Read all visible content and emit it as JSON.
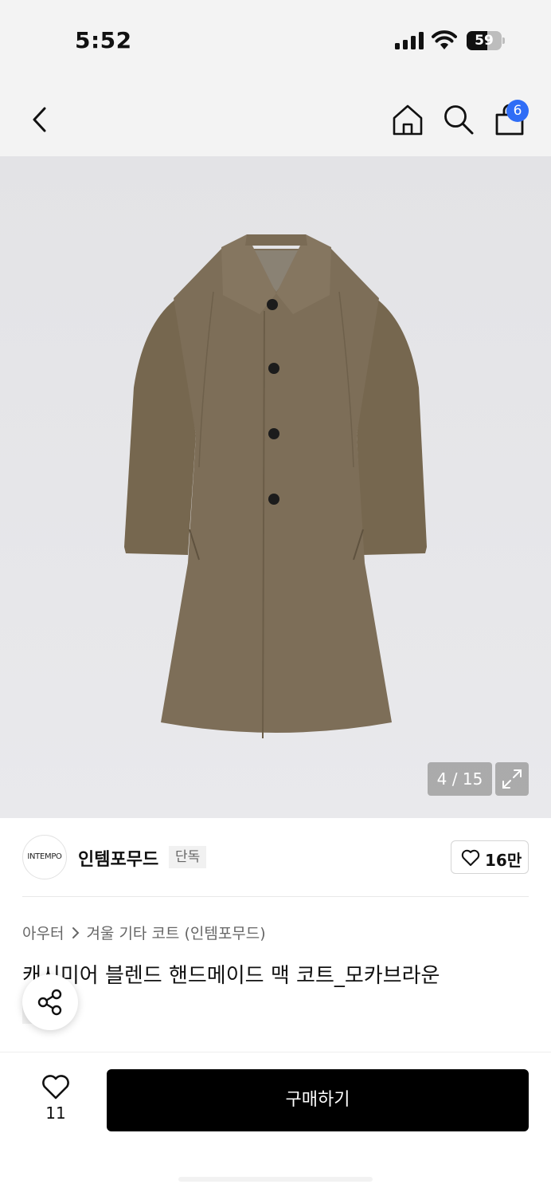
{
  "status_bar": {
    "time": "5:52",
    "battery_level": "59",
    "battery_fraction": 0.59,
    "icons": [
      "signal-icon",
      "wifi-icon",
      "battery-icon"
    ]
  },
  "nav": {
    "icons": [
      "back-icon",
      "home-icon",
      "search-icon",
      "bag-icon"
    ],
    "cart_count": "6"
  },
  "gallery": {
    "counter": "4 / 15",
    "icons": [
      "chevron-right-icon",
      "expand-icon"
    ]
  },
  "brand": {
    "logo_text": "INTEMPO",
    "name": "인템포무드",
    "tag": "단독",
    "follow_count": "16만",
    "follow_icon": "heart-outline-icon"
  },
  "product": {
    "breadcrumb": [
      "아우터",
      "겨울 기타 코트 (인템포무드)"
    ],
    "title": "캐시미어 블렌드 핸드메이드 맥 코트_모카브라운",
    "tag": "단독",
    "share_icon": "share-icon"
  },
  "bottom_bar": {
    "wish_count": "11",
    "buy_label": "구매하기"
  },
  "colors": {
    "accent_badge": "#2f6df6",
    "buy_button": "#000000",
    "coat": "#7d6e58"
  }
}
